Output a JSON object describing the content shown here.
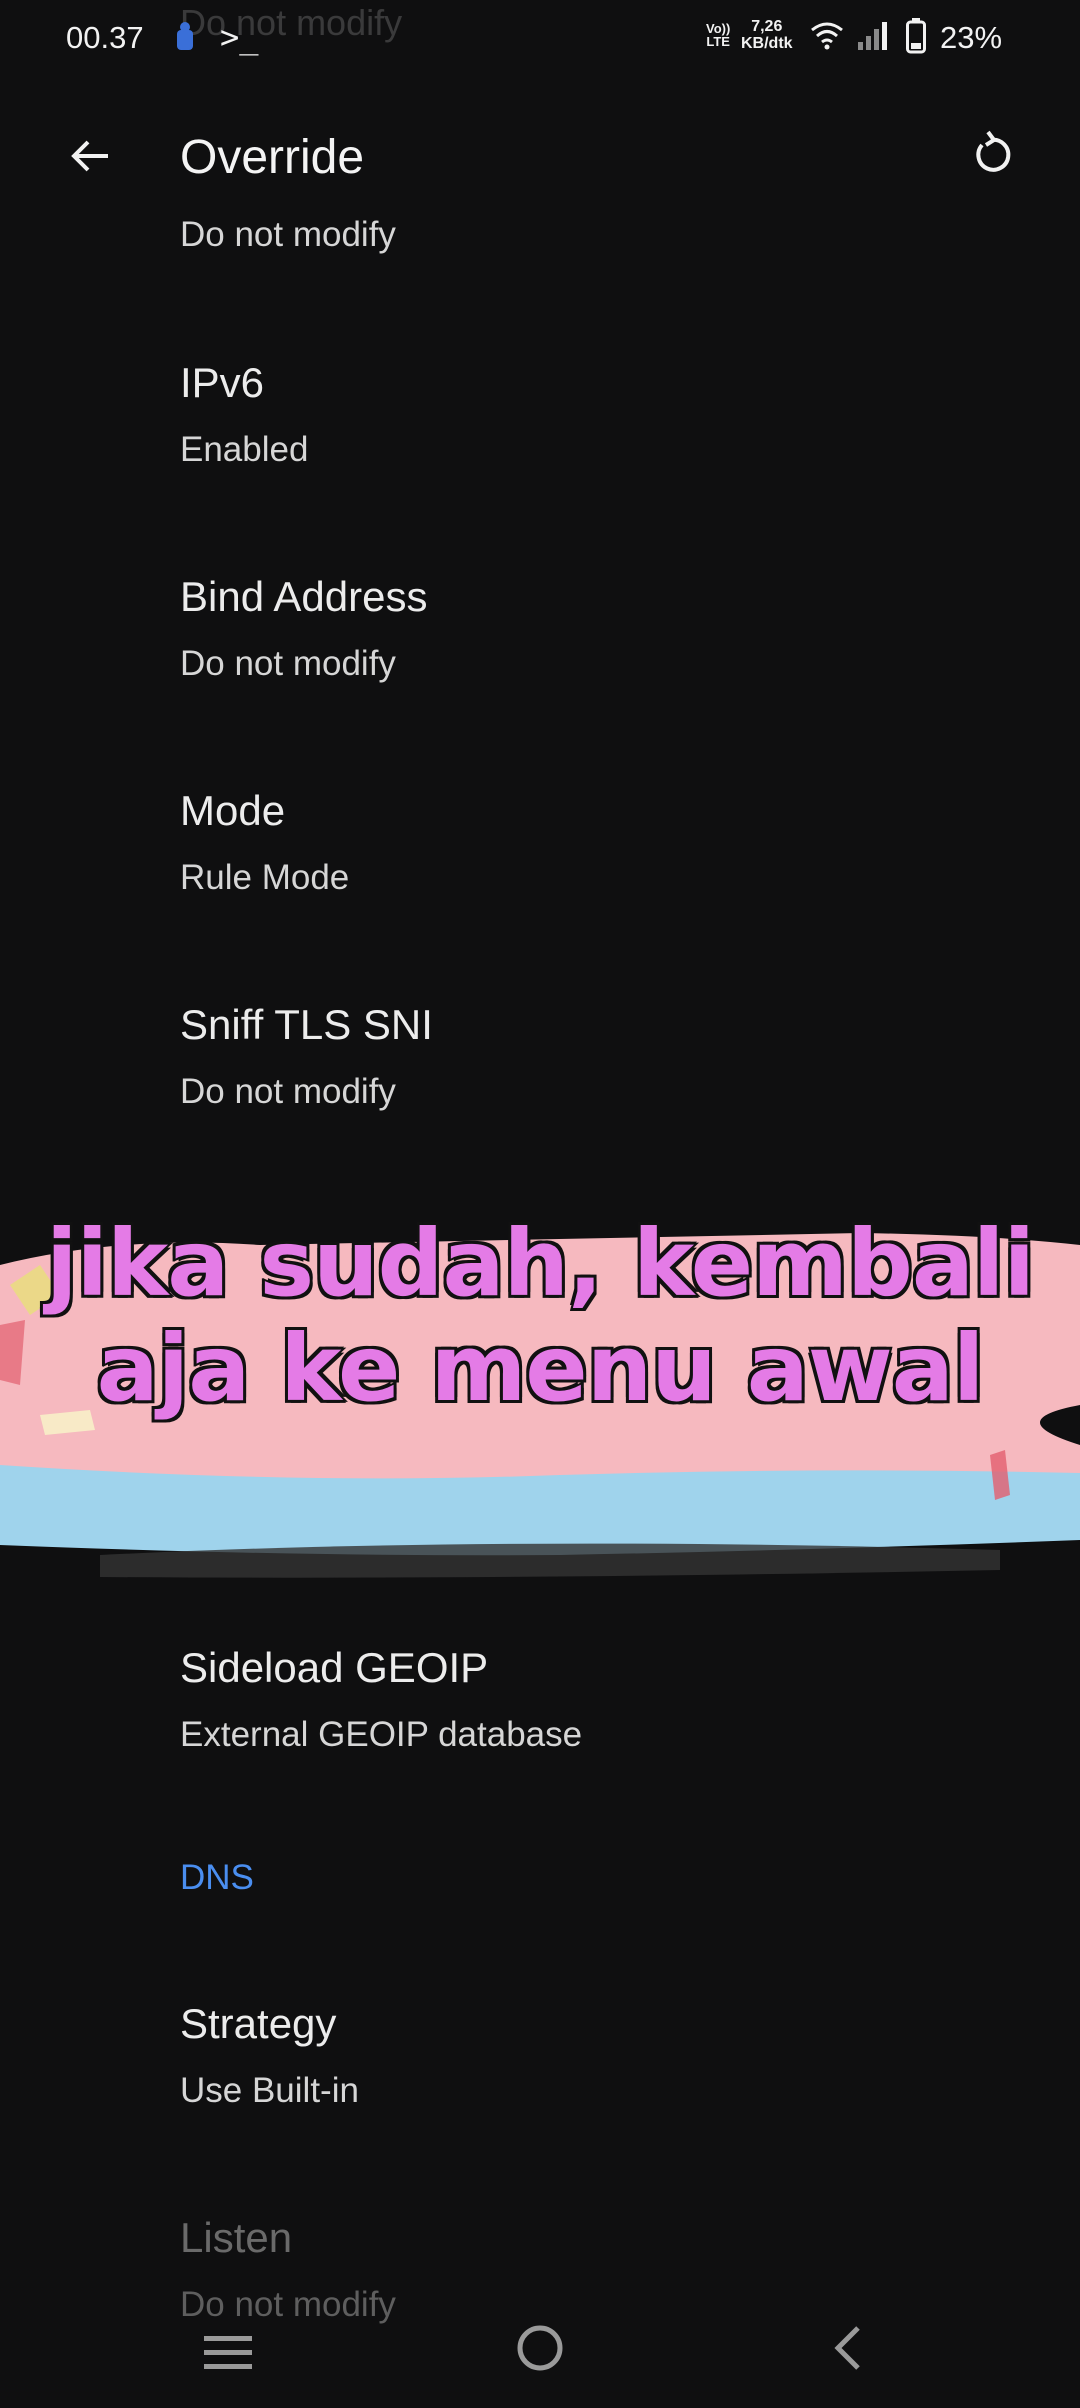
{
  "status_bar": {
    "time": "00.37",
    "terminal_glyph": ">_",
    "volte_line1": "Vo))",
    "volte_line2": "LTE",
    "speed_value": "7,26",
    "speed_unit": "KB/dtk",
    "battery_percent": "23%",
    "ghost_text": "Do not modify"
  },
  "app_bar": {
    "title": "Override",
    "back_icon": "arrow-left-icon",
    "reset_icon": "restore-icon"
  },
  "list": {
    "partial_top_subtitle": "Do not modify",
    "items": [
      {
        "title": "IPv6",
        "subtitle": "Enabled"
      },
      {
        "title": "Bind Address",
        "subtitle": "Do not modify"
      },
      {
        "title": "Mode",
        "subtitle": "Rule Mode"
      },
      {
        "title": "Sniff TLS SNI",
        "subtitle": "Do not modify"
      },
      {
        "title": "Sideload GEOIP",
        "subtitle": "External GEOIP database"
      }
    ],
    "dns_section": {
      "header": "DNS",
      "items": [
        {
          "title": "Strategy",
          "subtitle": "Use Built-in"
        },
        {
          "title": "Listen",
          "subtitle": "Do not modify"
        }
      ]
    }
  },
  "overlay": {
    "line1": "jika sudah, kembali",
    "line2": "aja ke menu awal"
  },
  "colors": {
    "background": "#0f0f10",
    "accent": "#4a8ef0",
    "caption_fill": "#e47be6",
    "brush_pink": "#f6b9bf",
    "brush_blue": "#9fd3ec"
  },
  "nav_bar": {
    "recent_icon": "menu-lines-icon",
    "home_icon": "home-circle-icon",
    "back_icon": "chevron-left-icon"
  }
}
